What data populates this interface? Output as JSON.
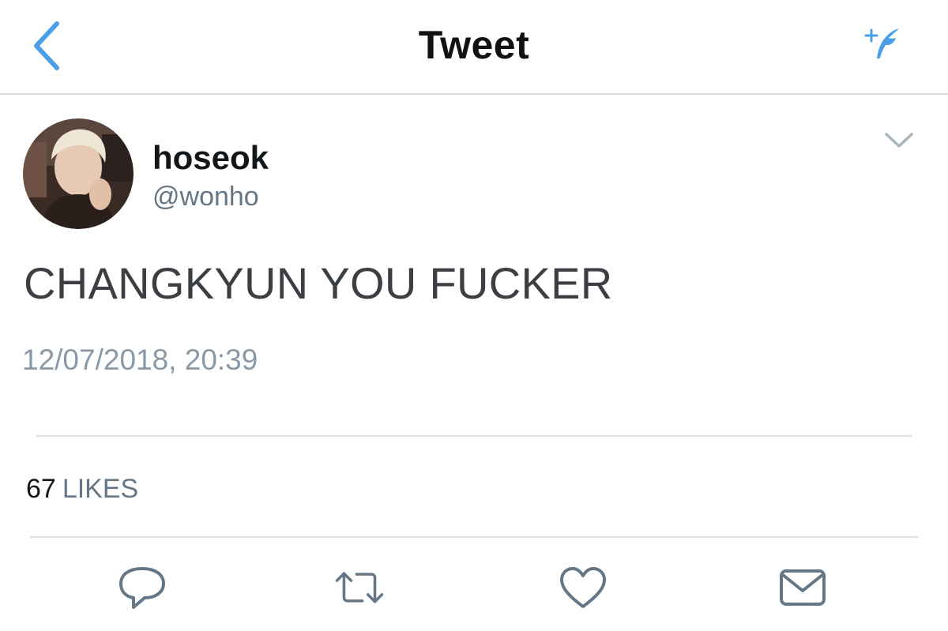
{
  "nav": {
    "title": "Tweet",
    "back_icon": "chevron-left-icon",
    "compose_icon": "compose-tweet-icon",
    "accent_color": "#4a9fe8"
  },
  "tweet": {
    "author": {
      "display_name": "hoseok",
      "handle": "@wonho",
      "avatar_icon": "avatar"
    },
    "text": "CHANGKYUN YOU FUCKER",
    "timestamp": "12/07/2018, 20:39",
    "caret_icon": "chevron-down-icon"
  },
  "stats": {
    "likes_count": "67",
    "likes_label": "LIKES"
  },
  "actions": [
    {
      "icon": "reply-icon"
    },
    {
      "icon": "retweet-icon"
    },
    {
      "icon": "like-icon"
    },
    {
      "icon": "direct-message-icon"
    }
  ]
}
